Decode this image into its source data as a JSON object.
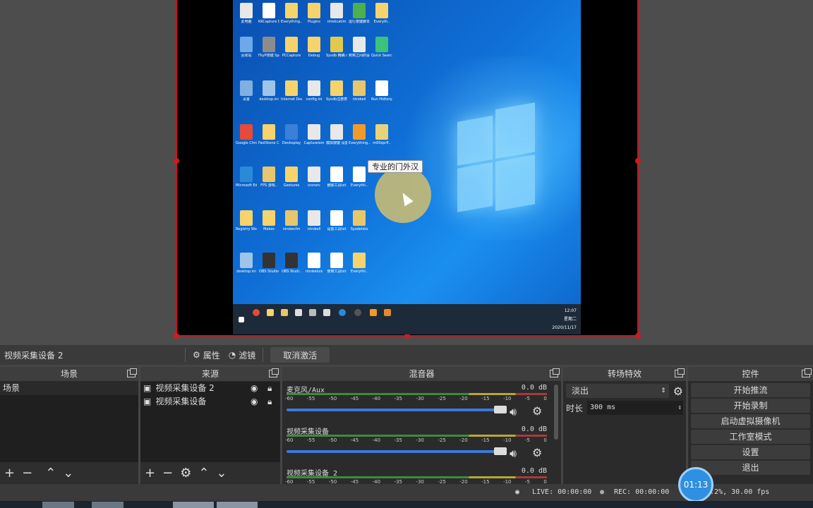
{
  "preview": {
    "tooltip": "专业的门外汉",
    "taskbar_time": "12:07",
    "taskbar_day": "星期二",
    "taskbar_date": "2020/11/17",
    "desktop_icons": [
      {
        "label": "此电脑",
        "color": "#e8e8e8"
      },
      {
        "label": "KKCapture 快速..",
        "color": "#ffffff"
      },
      {
        "label": "Everything..",
        "color": "#f6d36b"
      },
      {
        "label": "Plugins",
        "color": "#f6d36b"
      },
      {
        "label": "ntrokcatim",
        "color": "#e8e8e8"
      },
      {
        "label": "运行按键脚本 Sysdb..",
        "color": "#4caf50"
      },
      {
        "label": "Everyth..",
        "color": "#f6d36b"
      },
      {
        "label": "回收站",
        "color": "#6ea8e8"
      },
      {
        "label": "FkyP按键 Spe ..",
        "color": "#8c8c8c"
      },
      {
        "label": "PCCapture",
        "color": "#f6d36b"
      },
      {
        "label": "Debug",
        "color": "#f6d36b"
      },
      {
        "label": "Sysdb 精确 dbo",
        "color": "#e2c94c"
      },
      {
        "label": "奕奕之间的设 备配置.lnk",
        "color": "#e8e8e8"
      },
      {
        "label": "Quick Search",
        "color": "#3cc27a"
      },
      {
        "label": "设置",
        "color": "#7fb0e0"
      },
      {
        "label": "desktop.ini",
        "color": "#9fc4ea"
      },
      {
        "label": "Internet Downl..",
        "color": "#f6d36b"
      },
      {
        "label": "config.ini",
        "color": "#e8e8e8"
      },
      {
        "label": "Sysdb注册表 插件配置",
        "color": "#f6d36b"
      },
      {
        "label": "ntrokeil",
        "color": "#e8c66b"
      },
      {
        "label": "Run Hidtory.rv",
        "color": "#ffffff"
      },
      {
        "label": "Google Chrome",
        "color": "#e64a3a"
      },
      {
        "label": "FastStone Capture",
        "color": "#f6d36b"
      },
      {
        "label": "Devkoplay",
        "color": "#3a7fd8"
      },
      {
        "label": "Capturelsm",
        "color": "#e8e8e8"
      },
      {
        "label": "模拟按键 设置PSD",
        "color": "#e8e8e8"
      },
      {
        "label": "Everything..",
        "color": "#f09a2a"
      },
      {
        "label": "m00sprfl..",
        "color": "#e8d27a"
      },
      {
        "label": "Microsoft Edge",
        "color": "#2a8ad8"
      },
      {
        "label": "FPS 游戏..",
        "color": "#e8c66b"
      },
      {
        "label": "Gestures",
        "color": "#f6d36b"
      },
      {
        "label": "iconsrc",
        "color": "#e8e8e8"
      },
      {
        "label": "删除工具txt",
        "color": "#ffffff"
      },
      {
        "label": "Everythi..",
        "color": "#ffffff"
      },
      {
        "label": "Registry Workshop",
        "color": "#f6d36b"
      },
      {
        "label": "Makes",
        "color": "#f6d36b"
      },
      {
        "label": "nirokecfm",
        "color": "#e8c66b"
      },
      {
        "label": "ntrokell",
        "color": "#e8e8e8"
      },
      {
        "label": "设置工具txt",
        "color": "#ffffff"
      },
      {
        "label": "Sysdetsto",
        "color": "#e8c66b"
      },
      {
        "label": "desktop.ini",
        "color": "#9fc4ea"
      },
      {
        "label": "OBS Studio",
        "color": "#333333"
      },
      {
        "label": "OBS Studi..",
        "color": "#333333"
      },
      {
        "label": "ntrokeluis",
        "color": "#ffffff"
      },
      {
        "label": "使用工具txt",
        "color": "#ffffff"
      },
      {
        "label": "Everythi..",
        "color": "#f6d36b"
      }
    ]
  },
  "source_bar": {
    "current_source": "视频采集设备 2",
    "properties": "属性",
    "filters": "滤镜",
    "deactivate": "取消激活"
  },
  "docks": {
    "scenes": {
      "title": "场景",
      "items": [
        "场景"
      ]
    },
    "sources": {
      "title": "来源",
      "items": [
        "视频采集设备 2",
        "视频采集设备"
      ]
    },
    "mixer": {
      "title": "混音器",
      "ticks": [
        "-60",
        "-55",
        "-50",
        "-45",
        "-40",
        "-35",
        "-30",
        "-25",
        "-20",
        "-15",
        "-10",
        "-5",
        "0"
      ],
      "channels": [
        {
          "name": "麦克风/Aux",
          "db": "0.0 dB",
          "volume": 1.0
        },
        {
          "name": "视频采集设备",
          "db": "0.0 dB",
          "volume": 1.0
        },
        {
          "name": "视频采集设备 2",
          "db": "0.0 dB",
          "volume": 1.0
        }
      ]
    },
    "transitions": {
      "title": "转场特效",
      "selected": "淡出",
      "duration_label": "时长",
      "duration_value": "300 ms"
    },
    "controls": {
      "title": "控件",
      "buttons": [
        "开始推流",
        "开始录制",
        "启动虚拟摄像机",
        "工作室模式",
        "设置",
        "退出"
      ]
    }
  },
  "status": {
    "live": "LIVE: 00:00:00",
    "rec": "REC: 00:00:00",
    "cpu_fps": "3.2%, 30.00 fps",
    "timer": "01:13"
  }
}
